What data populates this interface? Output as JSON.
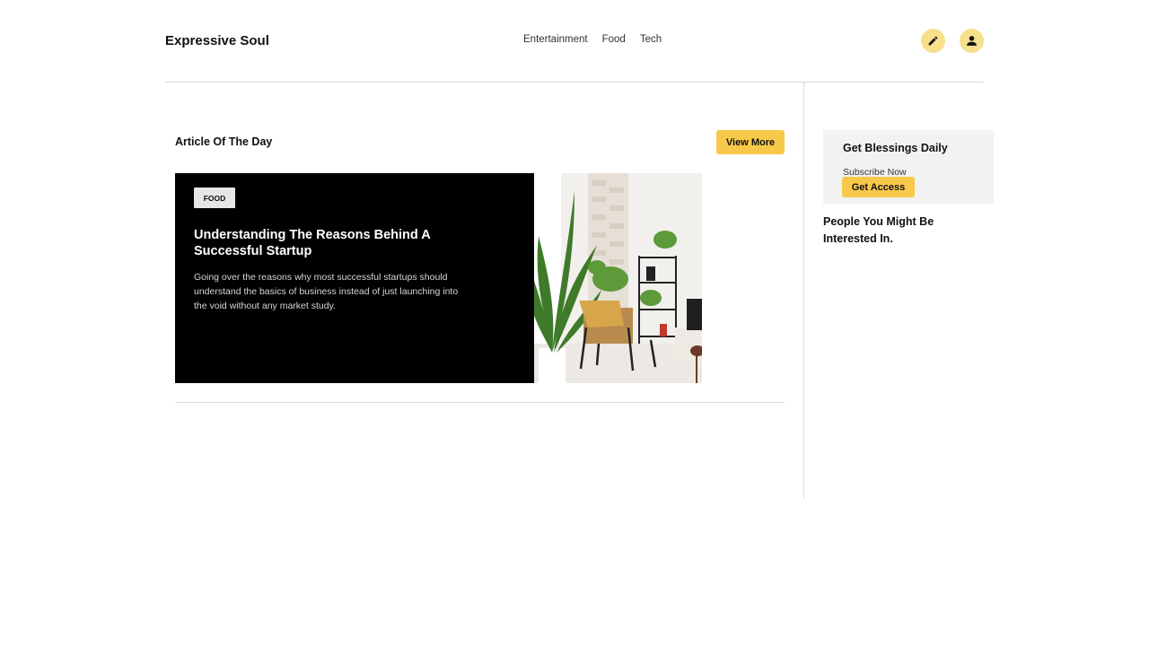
{
  "header": {
    "logo": "Expressive Soul",
    "nav": [
      "Entertainment",
      "Food",
      "Tech"
    ],
    "icons": [
      "pencil-icon",
      "user-icon"
    ],
    "accent_color": "#f7df8c"
  },
  "main": {
    "section_title": "Article Of The Day",
    "view_more_label": "View More",
    "article": {
      "tag": "FOOD",
      "title": "Understanding The Reasons Behind A Successful Startup",
      "description": "Going over the reasons why most successful startups should understand the basics of business instead of just launching into the void without any market study."
    }
  },
  "sidebar": {
    "subscribe_title": "Get Blessings Daily",
    "subscribe_text": "Subscribe Now",
    "access_label": "Get Access",
    "people_title": "People You Might Be Interested In."
  },
  "colors": {
    "button_yellow": "#f7c84a",
    "card_bg": "#000000",
    "sidebar_box_bg": "#f2f2f2"
  }
}
